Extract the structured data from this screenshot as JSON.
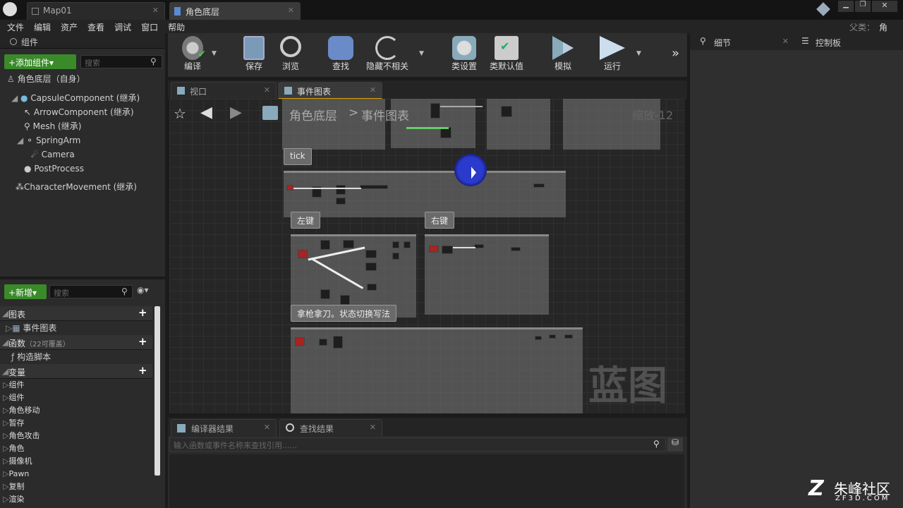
{
  "title_tabs": [
    {
      "label": "Map01"
    },
    {
      "label": "角色底层"
    }
  ],
  "parent_label": "父类：",
  "parent_value": "角色",
  "menu": [
    "文件",
    "编辑",
    "资产",
    "查看",
    "调试",
    "窗口",
    "帮助"
  ],
  "components_panel": {
    "title": "组件",
    "add_button": "+添加组件▾",
    "search_placeholder": "搜索",
    "self_label": "角色底层（自身）",
    "tree": [
      "CapsuleComponent (继承)",
      "ArrowComponent (继承)",
      "Mesh (继承)",
      "SpringArm",
      "Camera",
      "PostProcess",
      "CharacterMovement (继承)"
    ]
  },
  "my_blueprint": {
    "new_button": "+新增▾",
    "search_placeholder": "搜索",
    "graphs_label": "图表",
    "event_graph": "事件图表",
    "functions_label": "函数",
    "functions_note": "（22可覆盖）",
    "construction_script": "构造脚本",
    "variables_label": "变量",
    "variable_categories": [
      "组件",
      "组件",
      "角色移动",
      "暂存",
      "角色攻击",
      "角色",
      "摄像机",
      "Pawn",
      "复制",
      "渲染"
    ]
  },
  "toolbar": [
    {
      "label": "编译"
    },
    {
      "label": "保存"
    },
    {
      "label": "浏览"
    },
    {
      "label": "查找"
    },
    {
      "label": "隐藏不相关"
    },
    {
      "label": "类设置"
    },
    {
      "label": "类默认值"
    },
    {
      "label": "模拟"
    },
    {
      "label": "运行"
    }
  ],
  "editor_tabs": [
    {
      "label": "视口"
    },
    {
      "label": "事件图表"
    }
  ],
  "graph": {
    "breadcrumb_root": "角色底层",
    "breadcrumb_separator": ">",
    "breadcrumb_current": "事件图表",
    "zoom": "缩放-12",
    "watermark": "蓝图",
    "comments": [
      {
        "label": "tick"
      },
      {
        "label": "左键"
      },
      {
        "label": "右键"
      },
      {
        "label": "拿枪拿刀。状态切换写法"
      }
    ]
  },
  "bottom": {
    "tabs": [
      {
        "label": "编译器结果"
      },
      {
        "label": "查找结果"
      }
    ],
    "search_placeholder": "输入函数或事件名称来查找引用......"
  },
  "right_tabs": [
    {
      "label": "细节"
    },
    {
      "label": "控制板"
    }
  ],
  "logo": {
    "brand": "朱峰社区",
    "url": "ZF3D.COM"
  }
}
